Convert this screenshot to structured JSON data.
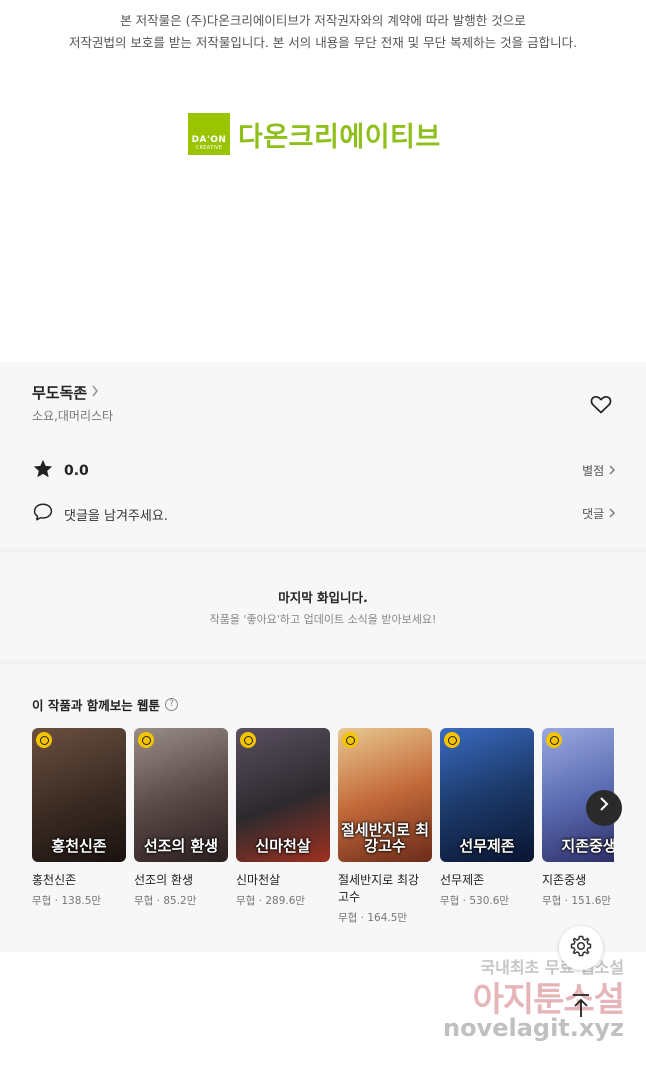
{
  "notice": {
    "line1": "본 저작물은 (주)다온크리에이티브가 저작권자와의 계약에 따라 발행한 것으로",
    "line2": "저작권법의 보호를 받는 저작물입니다. 본 서의 내용을 무단 전재 및 무단 복제하는 것을 금합니다."
  },
  "logo": {
    "box_line1": "DA'ON",
    "box_line2": "CREATIVE",
    "text": "다온크리에이티브",
    "color": "#9bc400"
  },
  "work": {
    "title": "무도독존",
    "authors": "소요,대머리스타",
    "rating": "0.0",
    "rating_link": "별점",
    "comment_prompt": "댓글을 남겨주세요.",
    "comment_link": "댓글"
  },
  "last_episode": {
    "title": "마지막 화입니다.",
    "subtitle": "작품을 '좋아요'하고 업데이트 소식을 받아보세요!"
  },
  "recommendations": {
    "title": "이 작품과 함께보는 웹툰",
    "items": [
      {
        "cover": "홍천신존",
        "name": "홍천신존",
        "genre": "무협",
        "views": "138.5만",
        "bg": "#3a2a22"
      },
      {
        "cover": "선조의 환생",
        "name": "선조의 환생",
        "genre": "무협",
        "views": "85.2만",
        "bg": "#5a4a48"
      },
      {
        "cover": "신마천살",
        "name": "신마천살",
        "genre": "무협",
        "views": "289.6만",
        "bg": "#2c2a2e"
      },
      {
        "cover": "절세반지로 최강고수",
        "name": "절세반지로 최강 고수",
        "genre": "무협",
        "views": "164.5만",
        "bg": "#c46a3a"
      },
      {
        "cover": "선무제존",
        "name": "선무제존",
        "genre": "무협",
        "views": "530.6만",
        "bg": "#1c3a6a"
      },
      {
        "cover": "지존중생",
        "name": "지존중생",
        "genre": "무협",
        "views": "151.6만",
        "bg": "#5a6ab0"
      }
    ]
  },
  "watermark": {
    "line1": "국내최초 무료 웹소설",
    "line2": "아지툰소설",
    "line3": "novelagit.xyz"
  }
}
